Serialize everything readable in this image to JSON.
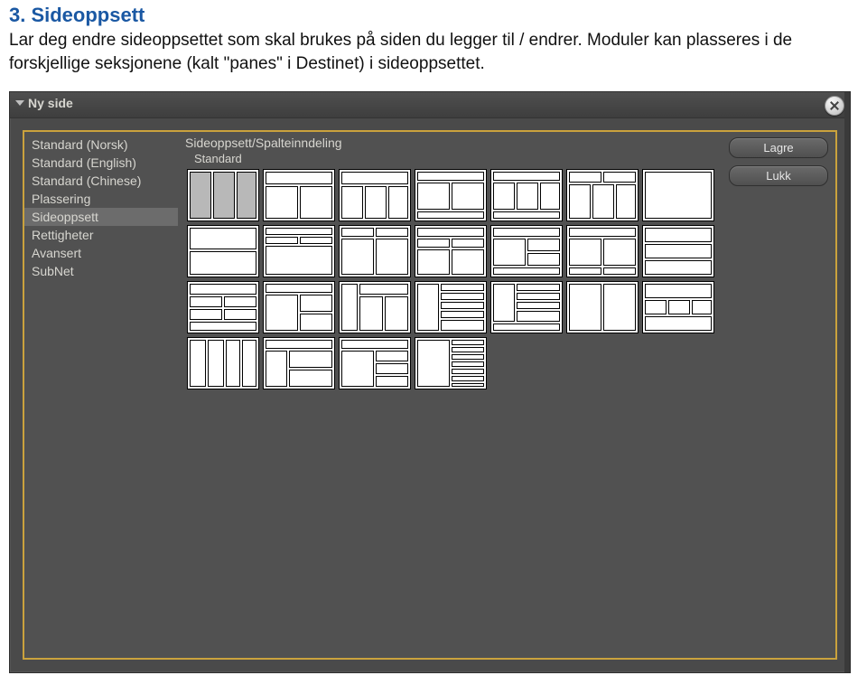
{
  "doc": {
    "heading": "3. Sideoppsett",
    "body": "Lar deg endre sideoppsettet som skal brukes på siden du legger til / endrer. Moduler kan plasseres i de forskjellige seksjonene (kalt \"panes\" i Destinet) i sideoppsettet."
  },
  "window": {
    "title": "Ny side"
  },
  "sidebar": {
    "items": [
      {
        "label": "Standard (Norsk)"
      },
      {
        "label": "Standard (English)"
      },
      {
        "label": "Standard (Chinese)"
      },
      {
        "label": "Plassering"
      },
      {
        "label": "Sideoppsett"
      },
      {
        "label": "Rettigheter"
      },
      {
        "label": "Avansert"
      },
      {
        "label": "SubNet"
      }
    ],
    "selected_index": 4
  },
  "main": {
    "title": "Sideoppsett/Spalteinndeling",
    "selected_layout_label": "Standard"
  },
  "buttons": {
    "save": "Lagre",
    "close": "Lukk"
  }
}
